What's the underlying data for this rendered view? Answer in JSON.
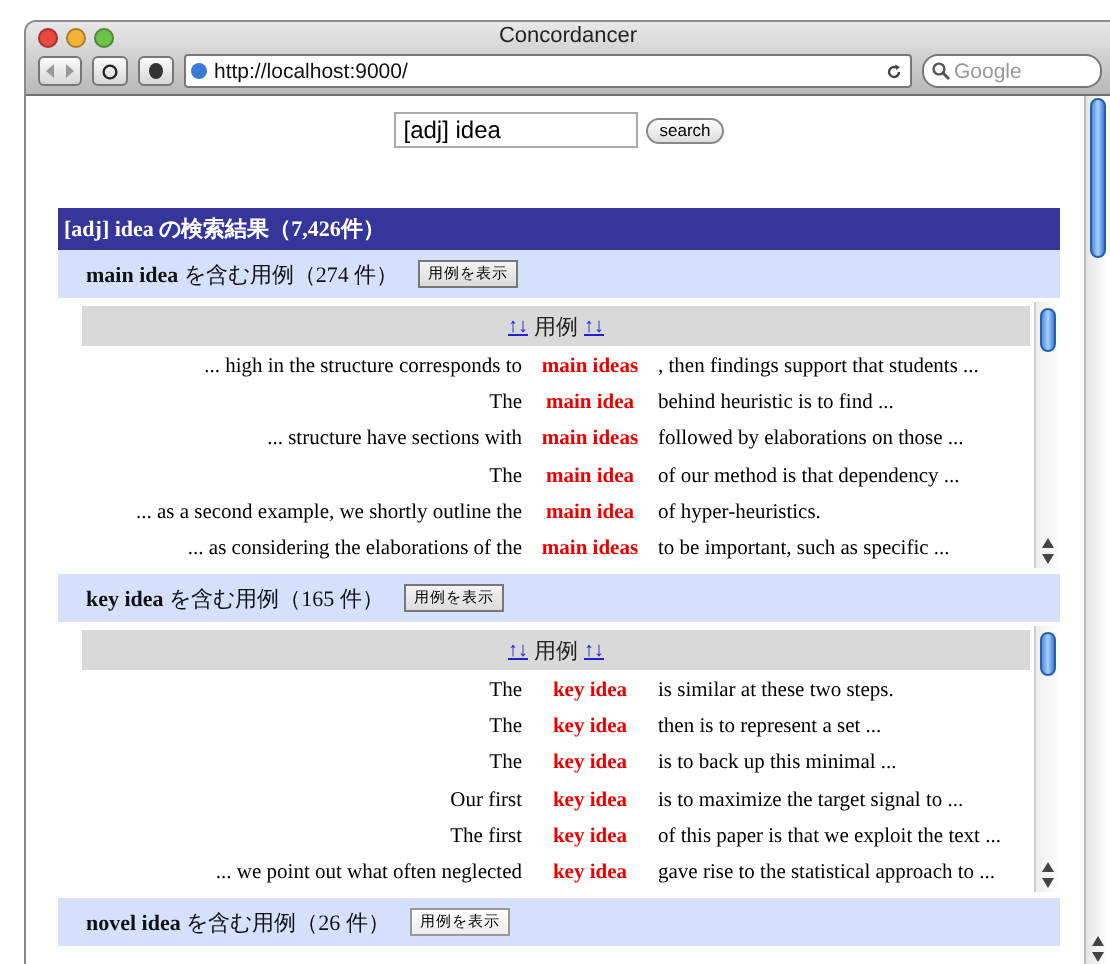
{
  "window": {
    "title": "Concordancer"
  },
  "toolbar": {
    "url": "http://localhost:9000/",
    "search_placeholder": "Google"
  },
  "query": {
    "value": "[adj] idea",
    "button": "search"
  },
  "results": {
    "title": "[adj] idea の検索結果（7,426件）",
    "groups": [
      {
        "phrase": "main idea",
        "label": "を含む用例（274 件）",
        "button": "用例を表示",
        "expanded": true,
        "table": {
          "sort_left": "↑↓",
          "header": "用例",
          "sort_right": "↑↓",
          "rows": [
            {
              "left": "... high in the structure corresponds to",
              "keyword": "main ideas",
              "right": ", then findings support that students ..."
            },
            {
              "left": "The",
              "keyword": "main idea",
              "right": "behind heuristic is to find ..."
            },
            {
              "left": "... structure have sections with",
              "keyword": "main ideas",
              "right": "followed by elaborations on those ..."
            },
            {
              "left": "The",
              "keyword": "main idea",
              "right": "of our method is that dependency ..."
            },
            {
              "left": "... as a second example, we shortly outline the",
              "keyword": "main idea",
              "right": "of hyper-heuristics."
            },
            {
              "left": "... as considering the elaborations of the",
              "keyword": "main ideas",
              "right": "to be important, such as specific ..."
            }
          ]
        }
      },
      {
        "phrase": "key idea",
        "label": "を含む用例（165 件）",
        "button": "用例を表示",
        "expanded": true,
        "table": {
          "sort_left": "↑↓",
          "header": "用例",
          "sort_right": "↑↓",
          "rows": [
            {
              "left": "The",
              "keyword": "key idea",
              "right": "is similar at these two steps."
            },
            {
              "left": "The",
              "keyword": "key idea",
              "right": "then is to represent a set ..."
            },
            {
              "left": "The",
              "keyword": "key idea",
              "right": "is to back up this minimal ..."
            },
            {
              "left": "Our first",
              "keyword": "key idea",
              "right": "is to maximize the target signal to ..."
            },
            {
              "left": "The first",
              "keyword": "key idea",
              "right": "of this paper is that we exploit the text ..."
            },
            {
              "left": "... we point out what often neglected",
              "keyword": "key idea",
              "right": "gave rise to the statistical approach to ..."
            }
          ]
        }
      },
      {
        "phrase": "novel idea",
        "label": "を含む用例（26 件）",
        "button": "用例を表示",
        "expanded": false
      }
    ]
  }
}
